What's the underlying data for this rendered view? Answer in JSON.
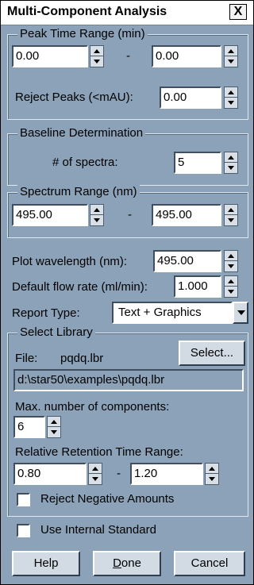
{
  "window": {
    "title": "Multi-Component Analysis",
    "close_label": "X"
  },
  "peak_time": {
    "legend": "Peak Time Range (min)",
    "start": "0.00",
    "dash": "-",
    "end": "0.00",
    "reject_label": "Reject Peaks (<mAU):",
    "reject_value": "0.00"
  },
  "baseline": {
    "legend": "Baseline Determination",
    "spectra_label": "# of spectra:",
    "spectra_value": "5"
  },
  "spectrum_range": {
    "legend": "Spectrum Range (nm)",
    "start": "495.00",
    "dash": "-",
    "end": "495.00"
  },
  "plot_wavelength": {
    "label": "Plot wavelength (nm):",
    "value": "495.00"
  },
  "flow_rate": {
    "label": "Default flow rate (ml/min):",
    "value": "1.000"
  },
  "report_type": {
    "label": "Report Type:",
    "value": "Text + Graphics"
  },
  "library": {
    "legend": "Select Library",
    "file_label": "File:",
    "file_name": "pqdq.lbr",
    "select_button": "Select...",
    "path": "d:\\star50\\examples\\pqdq.lbr",
    "max_components_label": "Max. number of components:",
    "max_components_value": "6",
    "rrt_label": "Relative Retention Time Range:",
    "rrt_start": "0.80",
    "rrt_dash": "-",
    "rrt_end": "1.20",
    "reject_negative_label": "Reject Negative Amounts"
  },
  "internal_standard_label": "Use Internal Standard",
  "buttons": {
    "help": "Help",
    "done": "Done",
    "cancel": "Cancel"
  }
}
